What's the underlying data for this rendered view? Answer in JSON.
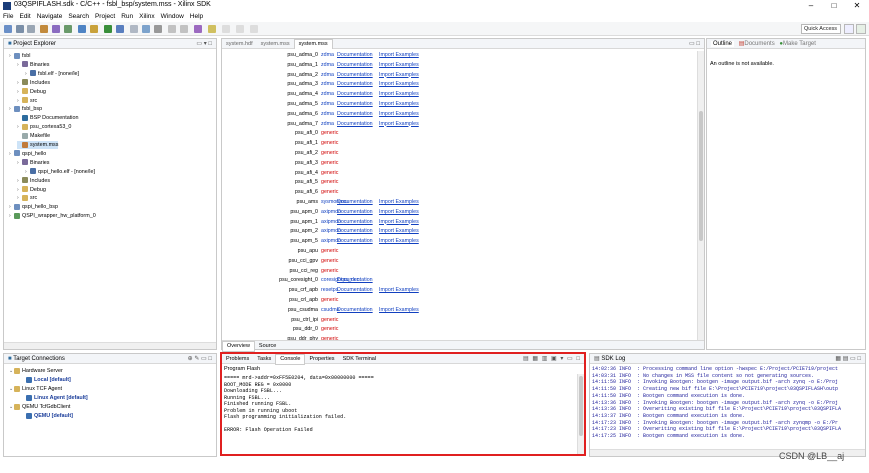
{
  "window": {
    "title": "03QSPIFLASH.sdk - C/C++ - fsbl_bsp/system.mss - Xilinx SDK",
    "minimize": "–",
    "maximize": "□",
    "close": "✕"
  },
  "menu": [
    "File",
    "Edit",
    "Navigate",
    "Search",
    "Project",
    "Run",
    "Xilinx",
    "Window",
    "Help"
  ],
  "quick_access": "Quick Access",
  "project_explorer": {
    "title": "Project Explorer",
    "items": [
      {
        "label": "fsbl",
        "level": 0,
        "icon": "project"
      },
      {
        "label": "Binaries",
        "level": 1,
        "icon": "binaries"
      },
      {
        "label": "fsbl.elf - [none/le]",
        "level": 2,
        "icon": "elf"
      },
      {
        "label": "Includes",
        "level": 1,
        "icon": "includes"
      },
      {
        "label": "Debug",
        "level": 1,
        "icon": "folder"
      },
      {
        "label": "src",
        "level": 1,
        "icon": "folder"
      },
      {
        "label": "fsbl_bsp",
        "level": 0,
        "icon": "project"
      },
      {
        "label": "BSP Documentation",
        "level": 1,
        "icon": "info"
      },
      {
        "label": "psu_cortexa53_0",
        "level": 1,
        "icon": "folder"
      },
      {
        "label": "Makefile",
        "level": 1,
        "icon": "file"
      },
      {
        "label": "system.mss",
        "level": 1,
        "icon": "mss"
      },
      {
        "label": "qspi_hello",
        "level": 0,
        "icon": "project"
      },
      {
        "label": "Binaries",
        "level": 1,
        "icon": "binaries"
      },
      {
        "label": "qspi_hello.elf - [none/le]",
        "level": 2,
        "icon": "elf"
      },
      {
        "label": "Includes",
        "level": 1,
        "icon": "includes"
      },
      {
        "label": "Debug",
        "level": 1,
        "icon": "folder"
      },
      {
        "label": "src",
        "level": 1,
        "icon": "folder"
      },
      {
        "label": "qspi_hello_bsp",
        "level": 0,
        "icon": "project"
      },
      {
        "label": "QSPI_wrapper_hw_platform_0",
        "level": 0,
        "icon": "hw"
      }
    ]
  },
  "editor": {
    "tabs": [
      "system.hdf",
      "system.mss",
      "system.mss"
    ],
    "bottom_tabs": [
      "Overview",
      "Source"
    ],
    "rows": [
      {
        "name": "psu_adma_0",
        "driver": "zdma",
        "docs": "Documentation",
        "ex": "Import Examples",
        "red": false
      },
      {
        "name": "psu_adma_1",
        "driver": "zdma",
        "docs": "Documentation",
        "ex": "Import Examples",
        "red": false
      },
      {
        "name": "psu_adma_2",
        "driver": "zdma",
        "docs": "Documentation",
        "ex": "Import Examples",
        "red": false
      },
      {
        "name": "psu_adma_3",
        "driver": "zdma",
        "docs": "Documentation",
        "ex": "Import Examples",
        "red": false
      },
      {
        "name": "psu_adma_4",
        "driver": "zdma",
        "docs": "Documentation",
        "ex": "Import Examples",
        "red": false
      },
      {
        "name": "psu_adma_5",
        "driver": "zdma",
        "docs": "Documentation",
        "ex": "Import Examples",
        "red": false
      },
      {
        "name": "psu_adma_6",
        "driver": "zdma",
        "docs": "Documentation",
        "ex": "Import Examples",
        "red": false
      },
      {
        "name": "psu_adma_7",
        "driver": "zdma",
        "docs": "Documentation",
        "ex": "Import Examples",
        "red": false
      },
      {
        "name": "psu_afi_0",
        "driver": "generic",
        "docs": "",
        "ex": "",
        "red": true
      },
      {
        "name": "psu_afi_1",
        "driver": "generic",
        "docs": "",
        "ex": "",
        "red": true
      },
      {
        "name": "psu_afi_2",
        "driver": "generic",
        "docs": "",
        "ex": "",
        "red": true
      },
      {
        "name": "psu_afi_3",
        "driver": "generic",
        "docs": "",
        "ex": "",
        "red": true
      },
      {
        "name": "psu_afi_4",
        "driver": "generic",
        "docs": "",
        "ex": "",
        "red": true
      },
      {
        "name": "psu_afi_5",
        "driver": "generic",
        "docs": "",
        "ex": "",
        "red": true
      },
      {
        "name": "psu_afi_6",
        "driver": "generic",
        "docs": "",
        "ex": "",
        "red": true
      },
      {
        "name": "psu_ams",
        "driver": "sysmonpsu",
        "docs": "Documentation",
        "ex": "Import Examples",
        "red": false
      },
      {
        "name": "psu_apm_0",
        "driver": "axipmon",
        "docs": "Documentation",
        "ex": "Import Examples",
        "red": false
      },
      {
        "name": "psu_apm_1",
        "driver": "axipmon",
        "docs": "Documentation",
        "ex": "Import Examples",
        "red": false
      },
      {
        "name": "psu_apm_2",
        "driver": "axipmon",
        "docs": "Documentation",
        "ex": "Import Examples",
        "red": false
      },
      {
        "name": "psu_apm_5",
        "driver": "axipmon",
        "docs": "Documentation",
        "ex": "Import Examples",
        "red": false
      },
      {
        "name": "psu_apu",
        "driver": "generic",
        "docs": "",
        "ex": "",
        "red": true
      },
      {
        "name": "psu_cci_gpv",
        "driver": "generic",
        "docs": "",
        "ex": "",
        "red": true
      },
      {
        "name": "psu_cci_reg",
        "driver": "generic",
        "docs": "",
        "ex": "",
        "red": true
      },
      {
        "name": "psu_coresight_0",
        "driver": "coresightps_dcc",
        "docs": "Documentation",
        "ex": "",
        "red": false
      },
      {
        "name": "psu_crf_apb",
        "driver": "resetps",
        "docs": "Documentation",
        "ex": "Import Examples",
        "red": false
      },
      {
        "name": "psu_crl_apb",
        "driver": "generic",
        "docs": "",
        "ex": "",
        "red": true
      },
      {
        "name": "psu_csudma",
        "driver": "csudma",
        "docs": "Documentation",
        "ex": "Import Examples",
        "red": false
      },
      {
        "name": "psu_ctrl_ipi",
        "driver": "generic",
        "docs": "",
        "ex": "",
        "red": true
      },
      {
        "name": "psu_ddr_0",
        "driver": "generic",
        "docs": "",
        "ex": "",
        "red": true
      },
      {
        "name": "psu_ddr_phy",
        "driver": "generic",
        "docs": "",
        "ex": "",
        "red": true
      },
      {
        "name": "psu_ddr_qos_ctrl",
        "driver": "generic",
        "docs": "",
        "ex": "",
        "red": true
      }
    ]
  },
  "outline": {
    "tabs": [
      "Outline",
      "Documents",
      "Make Target"
    ],
    "message": "An outline is not available."
  },
  "target_connections": {
    "title": "Target Connections",
    "items": [
      {
        "label": "Hardware Server",
        "level": 0,
        "bold": false
      },
      {
        "label": "Local [default]",
        "level": 1,
        "bold": true
      },
      {
        "label": "Linux TCF Agent",
        "level": 0,
        "bold": false
      },
      {
        "label": "Linux Agent [default]",
        "level": 1,
        "bold": true
      },
      {
        "label": "QEMU TcfGdbClient",
        "level": 0,
        "bold": false
      },
      {
        "label": "QEMU [default]",
        "level": 1,
        "bold": true
      }
    ]
  },
  "console": {
    "tabs": [
      "Problems",
      "Tasks",
      "Console",
      "Properties",
      "SDK Terminal"
    ],
    "header": "Program Flash",
    "lines": [
      "===== mrd->addr=0xFF5E0204, data=0x00000000 =====",
      "BOOT_MODE REG = 0x0000",
      "Downloading FSBL...",
      "Running FSBL...",
      "Finished running FSBL.",
      "Problem in running uboot",
      "Flash programming initialization failed.",
      "",
      "ERROR: Flash Operation Failed"
    ]
  },
  "sdk_log": {
    "title": "SDK Log",
    "lines": [
      "14:02:36 INFO  : Processing command line option -hwspec E:/Project/PCIE719/project",
      "14:03:31 INFO  : No changes in MSS file content so not generating sources.",
      "14:11:50 INFO  : Invoking Bootgen: bootgen -image output.bif -arch zynq -o E:/Proj",
      "14:11:50 INFO  : Creating new bif file E:\\Project\\PCIE719\\project\\03QSPIFLASH\\outp",
      "14:11:50 INFO  : Bootgen command execution is done.",
      "14:13:36 INFO  : Invoking Bootgen: bootgen -image output.bif -arch zynq -o E:/Proj",
      "14:13:36 INFO  : Overwriting existing bif file E:\\Project\\PCIE719\\project\\03QSPIFLA",
      "14:13:37 INFO  : Bootgen command execution is done.",
      "14:17:23 INFO  : Invoking Bootgen: bootgen -image output.bif -arch zynqmp -o E:/Pr",
      "14:17:23 INFO  : Overwriting existing bif file E:\\Project\\PCIE719\\project\\03QSPIFLA",
      "14:17:25 INFO  : Bootgen command execution is done."
    ]
  },
  "watermark": "CSDN @LB__aj"
}
